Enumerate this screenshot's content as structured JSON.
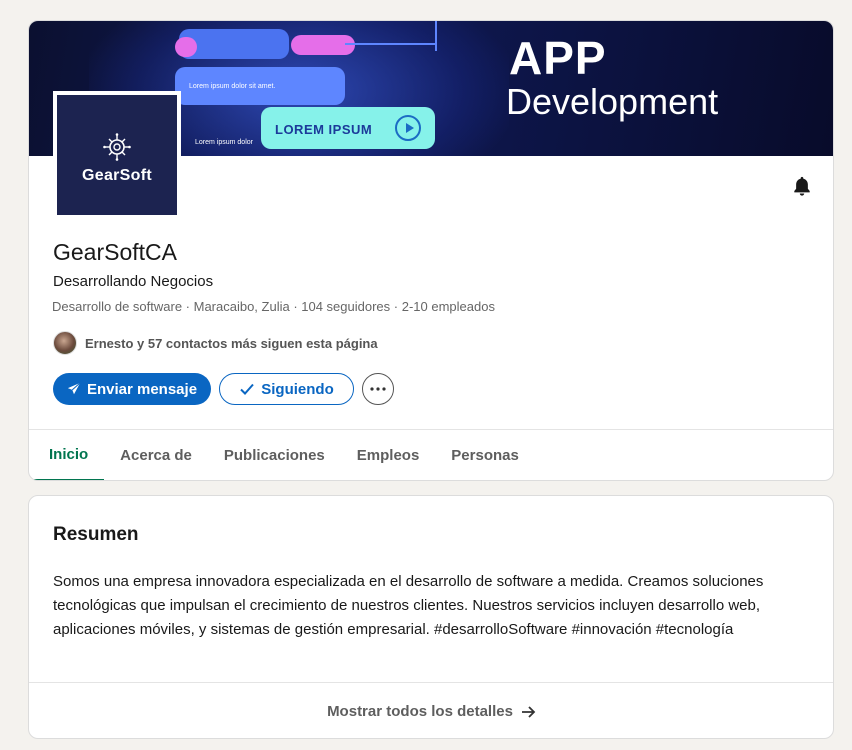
{
  "banner": {
    "title": "APP",
    "subtitle": "Development",
    "mock_button_label": "LOREM IPSUM",
    "mock_line_1": "Lorem ipsum dolor sit amet.",
    "mock_line_2": "Lorem ipsum dolor"
  },
  "company": {
    "logo_text": "GearSoft",
    "name": "GearSoftCA",
    "tagline": "Desarrollando Negocios",
    "meta": "Desarrollo de software · Maracaibo, Zulia · 104 seguidores · 2-10 empleados",
    "connections": "Ernesto y 57 contactos más siguen esta página"
  },
  "actions": {
    "message_label": "Enviar mensaje",
    "following_label": "Siguiendo",
    "more_icon": "more-icon",
    "bell_icon": "bell-icon"
  },
  "tabs": [
    {
      "label": "Inicio",
      "active": true
    },
    {
      "label": "Acerca de",
      "active": false
    },
    {
      "label": "Publicaciones",
      "active": false
    },
    {
      "label": "Empleos",
      "active": false
    },
    {
      "label": "Personas",
      "active": false
    }
  ],
  "about": {
    "title": "Resumen",
    "body": "Somos una empresa innovadora especializada en el desarrollo de software a medida. Creamos soluciones tecnológicas que impulsan el crecimiento de nuestros clientes. Nuestros servicios incluyen desarrollo web, aplicaciones móviles, y sistemas de gestión empresarial. #desarrolloSoftware #innovación #tecnología",
    "show_all_label": "Mostrar todos los detalles"
  },
  "colors": {
    "primary": "#0a66c2",
    "active_tab": "#01754f",
    "page_bg": "#f4f2ee"
  }
}
